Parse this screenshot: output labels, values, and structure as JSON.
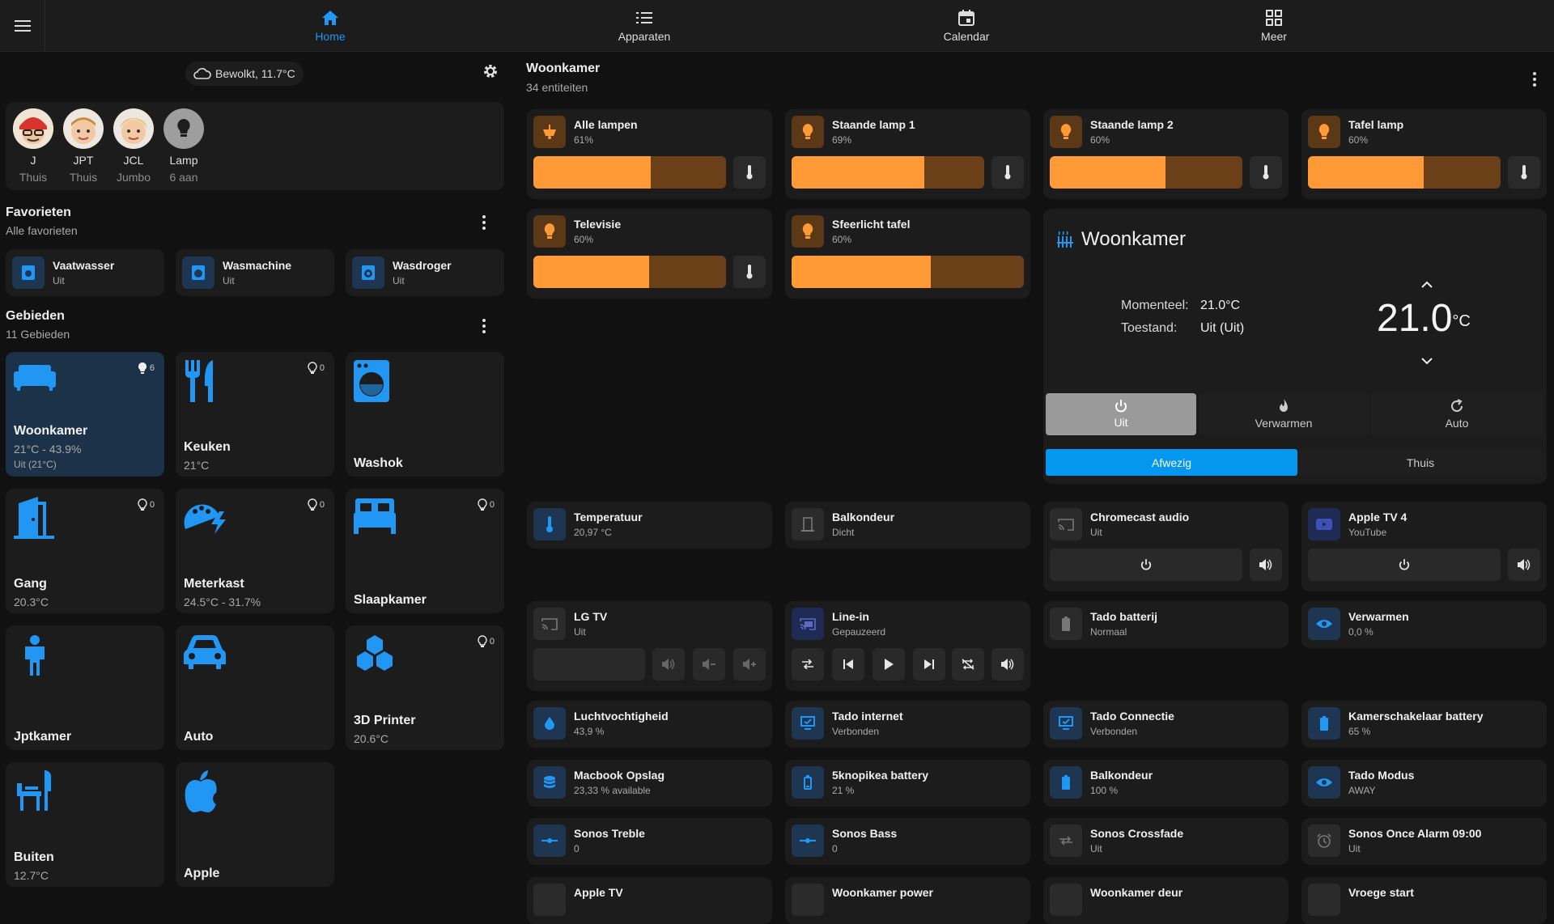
{
  "nav": {
    "tabs": [
      {
        "label": "Home",
        "icon": "home-icon"
      },
      {
        "label": "Apparaten",
        "icon": "list-icon"
      },
      {
        "label": "Calendar",
        "icon": "calendar-icon"
      },
      {
        "label": "Meer",
        "icon": "grid-icon"
      }
    ],
    "active": "Home",
    "accent": "#2196f3"
  },
  "weather": {
    "text": "Bewolkt, 11.7°C"
  },
  "persons": [
    {
      "name": "J",
      "state": "Thuis"
    },
    {
      "name": "JPT",
      "state": "Thuis"
    },
    {
      "name": "JCL",
      "state": "Jumbo"
    },
    {
      "name": "Lamp",
      "state": "6 aan"
    }
  ],
  "favorites": {
    "title": "Favorieten",
    "subtitle": "Alle favorieten",
    "items": [
      {
        "name": "Vaatwasser",
        "state": "Uit"
      },
      {
        "name": "Wasmachine",
        "state": "Uit"
      },
      {
        "name": "Wasdroger",
        "state": "Uit"
      }
    ]
  },
  "areas": {
    "title": "Gebieden",
    "subtitle": "11 Gebieden",
    "items": [
      {
        "name": "Woonkamer",
        "info": "21°C - 43.9%",
        "sub": "Uit (21°C)",
        "lights": "6"
      },
      {
        "name": "Keuken",
        "info": "21°C",
        "lights": "0"
      },
      {
        "name": "Washok"
      },
      {
        "name": "Gang",
        "info": "20.3°C",
        "lights": "0"
      },
      {
        "name": "Meterkast",
        "info": "24.5°C - 31.7%",
        "lights": "0"
      },
      {
        "name": "Slaapkamer",
        "lights": "0"
      },
      {
        "name": "Jptkamer"
      },
      {
        "name": "Auto"
      },
      {
        "name": "3D Printer",
        "info": "20.6°C",
        "lights": "0"
      },
      {
        "name": "Buiten",
        "info": "12.7°C"
      },
      {
        "name": "Apple"
      }
    ]
  },
  "room": {
    "title": "Woonkamer",
    "subtitle": "34 entiteiten",
    "lights": [
      {
        "name": "Alle lampen",
        "state": "61%",
        "level": 61
      },
      {
        "name": "Staande lamp 1",
        "state": "69%",
        "level": 69
      },
      {
        "name": "Staande lamp 2",
        "state": "60%",
        "level": 60
      },
      {
        "name": "Tafel lamp",
        "state": "60%",
        "level": 60
      },
      {
        "name": "Televisie",
        "state": "60%",
        "level": 60
      },
      {
        "name": "Sfeerlicht tafel",
        "state": "60%",
        "level": 60
      }
    ],
    "thermostat": {
      "name": "Woonkamer",
      "current_label": "Momenteel:",
      "current_value": "21.0°C",
      "state_label": "Toestand:",
      "state_value": "Uit (Uit)",
      "target": "21.0",
      "unit": "°C",
      "modes": [
        "Uit",
        "Verwarmen",
        "Auto"
      ],
      "active_mode": "Uit",
      "presets": [
        "Afwezig",
        "Thuis"
      ],
      "active_preset": "Afwezig"
    },
    "entities": [
      {
        "name": "Temperatuur",
        "state": "20,97 °C"
      },
      {
        "name": "Balkondeur",
        "state": "Dicht"
      },
      {
        "name": "Chromecast audio",
        "state": "Uit"
      },
      {
        "name": "Apple TV 4",
        "state": "YouTube"
      },
      {
        "name": "LG TV",
        "state": "Uit"
      },
      {
        "name": "Line-in",
        "state": "Gepauzeerd"
      },
      {
        "name": "Tado batterij",
        "state": "Normaal"
      },
      {
        "name": "Verwarmen",
        "state": "0,0 %"
      },
      {
        "name": "Luchtvochtigheid",
        "state": "43,9 %"
      },
      {
        "name": "Tado internet",
        "state": "Verbonden"
      },
      {
        "name": "Tado Connectie",
        "state": "Verbonden"
      },
      {
        "name": "Kamerschakelaar battery",
        "state": "65 %"
      },
      {
        "name": "Macbook Opslag",
        "state": "23,33 % available"
      },
      {
        "name": "5knopikea battery",
        "state": "21 %"
      },
      {
        "name": "Balkondeur",
        "state": "100 %"
      },
      {
        "name": "Tado Modus",
        "state": "AWAY"
      },
      {
        "name": "Sonos Treble",
        "state": "0"
      },
      {
        "name": "Sonos Bass",
        "state": "0"
      },
      {
        "name": "Sonos Crossfade",
        "state": "Uit"
      },
      {
        "name": "Sonos Once Alarm 09:00",
        "state": "Uit"
      },
      {
        "name": "Apple TV",
        "state": ""
      },
      {
        "name": "Woonkamer power",
        "state": ""
      },
      {
        "name": "Woonkamer deur",
        "state": ""
      },
      {
        "name": "Vroege start",
        "state": ""
      }
    ]
  },
  "colors": {
    "light_fill": "#ff9a36",
    "light_track": "#6b3f17",
    "icon_blue": "#2196f3",
    "icon_orange": "#ff9a36"
  }
}
